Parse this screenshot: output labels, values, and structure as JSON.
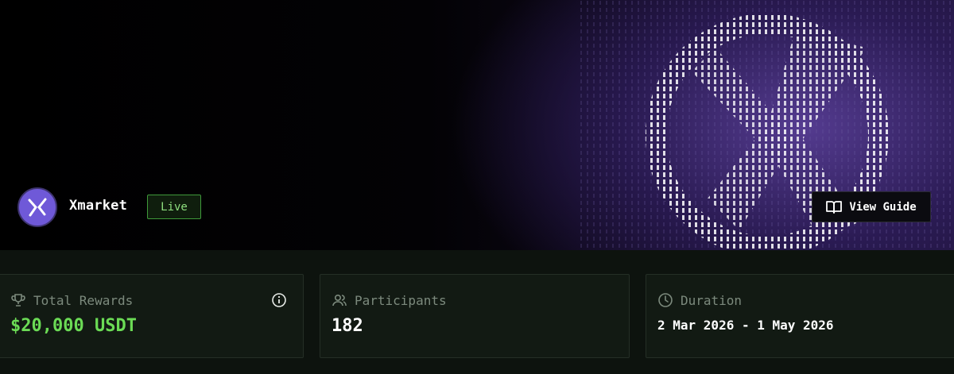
{
  "project": {
    "name": "Xmarket",
    "status": "Live",
    "logo_icon": "xmarket-logo-icon"
  },
  "actions": {
    "view_guide_label": "View Guide",
    "view_guide_icon": "book-icon"
  },
  "stats": {
    "total_rewards": {
      "label": "Total Rewards",
      "value": "$20,000 USDT",
      "icon": "trophy-icon"
    },
    "participants": {
      "label": "Participants",
      "value": "182",
      "icon": "users-icon"
    },
    "duration": {
      "label": "Duration",
      "value": "2 Mar 2026 - 1 May 2026",
      "icon": "clock-icon"
    }
  },
  "colors": {
    "accent_green": "#6bdb55",
    "badge_green": "#8ee07f",
    "brand_purple": "#6f59d8",
    "panel_bg": "#0d130e"
  }
}
